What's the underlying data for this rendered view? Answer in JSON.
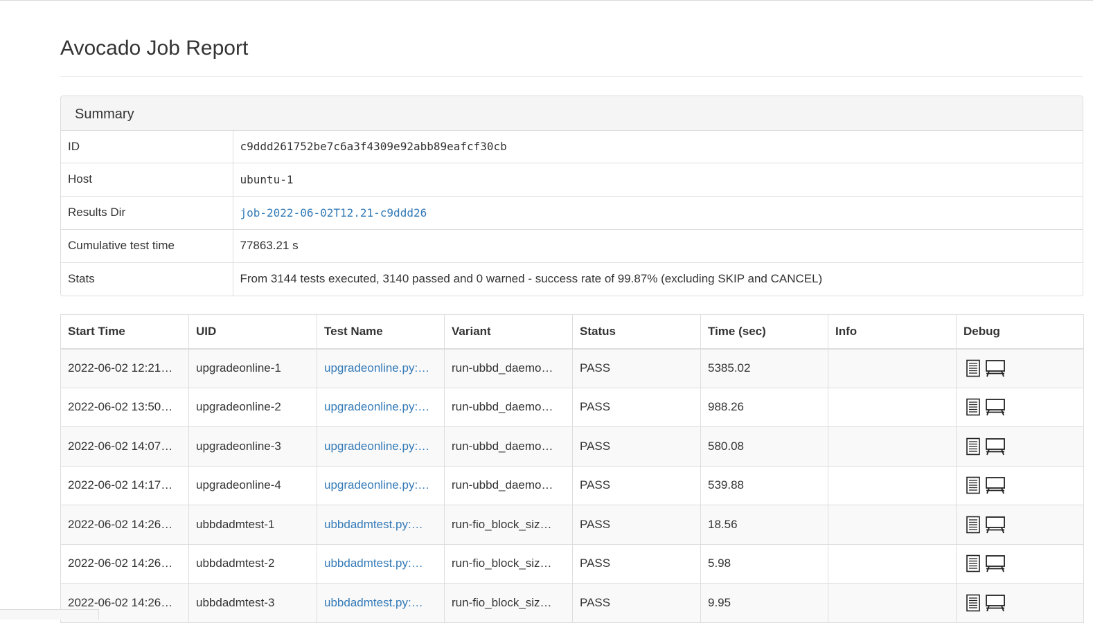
{
  "page": {
    "title": "Avocado Job Report"
  },
  "summary": {
    "heading": "Summary",
    "rows": [
      {
        "key": "ID",
        "value": "c9ddd261752be7c6a3f4309e92abb89eafcf30cb"
      },
      {
        "key": "Host",
        "value": "ubuntu-1"
      },
      {
        "key": "Results Dir",
        "value": "job-2022-06-02T12.21-c9ddd26"
      },
      {
        "key": "Cumulative test time",
        "value": "77863.21 s"
      },
      {
        "key": "Stats",
        "value": "From 3144 tests executed, 3140 passed and 0 warned - success rate of 99.87% (excluding SKIP and CANCEL)"
      }
    ]
  },
  "results": {
    "columns": [
      "Start Time",
      "UID",
      "Test Name",
      "Variant",
      "Status",
      "Time (sec)",
      "Info",
      "Debug"
    ],
    "rows": [
      {
        "start": "2022-06-02 12:21…",
        "uid": "upgradeonline-1",
        "test": "upgradeonline.py:…",
        "variant": "run-ubbd_daemo…",
        "status": "PASS",
        "time": "5385.02",
        "info": ""
      },
      {
        "start": "2022-06-02 13:50…",
        "uid": "upgradeonline-2",
        "test": "upgradeonline.py:…",
        "variant": "run-ubbd_daemo…",
        "status": "PASS",
        "time": "988.26",
        "info": ""
      },
      {
        "start": "2022-06-02 14:07…",
        "uid": "upgradeonline-3",
        "test": "upgradeonline.py:…",
        "variant": "run-ubbd_daemo…",
        "status": "PASS",
        "time": "580.08",
        "info": ""
      },
      {
        "start": "2022-06-02 14:17…",
        "uid": "upgradeonline-4",
        "test": "upgradeonline.py:…",
        "variant": "run-ubbd_daemo…",
        "status": "PASS",
        "time": "539.88",
        "info": ""
      },
      {
        "start": "2022-06-02 14:26…",
        "uid": "ubbdadmtest-1",
        "test": "ubbdadmtest.py:…",
        "variant": "run-fio_block_siz…",
        "status": "PASS",
        "time": "18.56",
        "info": ""
      },
      {
        "start": "2022-06-02 14:26…",
        "uid": "ubbdadmtest-2",
        "test": "ubbdadmtest.py:…",
        "variant": "run-fio_block_siz…",
        "status": "PASS",
        "time": "5.98",
        "info": ""
      },
      {
        "start": "2022-06-02 14:26…",
        "uid": "ubbdadmtest-3",
        "test": "ubbdadmtest.py:…",
        "variant": "run-fio_block_siz…",
        "status": "PASS",
        "time": "9.95",
        "info": ""
      }
    ],
    "debug_icons": [
      "log-file-icon",
      "sysinfo-terminal-icon"
    ]
  },
  "colors": {
    "link": "#337ab7",
    "border": "#dddddd",
    "stripe": "#f9f9f9",
    "heading_bg": "#f5f5f5"
  }
}
